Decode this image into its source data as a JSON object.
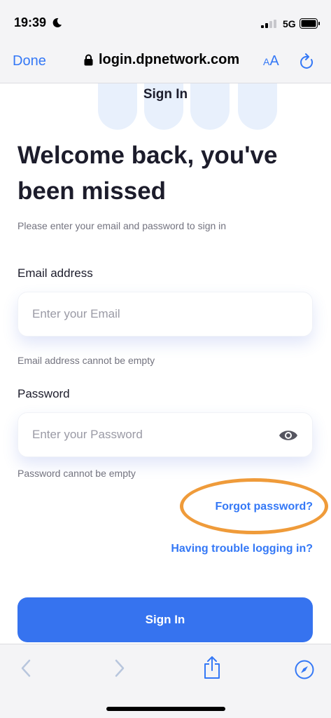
{
  "status_bar": {
    "time": "19:39",
    "network": "5G",
    "icons": [
      "moon-icon",
      "signal-icon",
      "battery-icon"
    ]
  },
  "browser": {
    "done_label": "Done",
    "url": "login.dpnetwork.com",
    "text_size_small": "A",
    "text_size_large": "A",
    "icons": [
      "lock-icon",
      "reload-icon",
      "back-icon",
      "forward-icon",
      "share-icon",
      "compass-icon"
    ]
  },
  "page": {
    "header": "Sign In",
    "title": "Welcome back, you've been missed",
    "subtitle": "Please enter your email and password to sign in",
    "email": {
      "label": "Email address",
      "placeholder": "Enter your Email",
      "value": "",
      "error": "Email address cannot be empty"
    },
    "password": {
      "label": "Password",
      "placeholder": "Enter your Password",
      "value": "",
      "error": "Password cannot be empty"
    },
    "forgot_password": "Forgot password?",
    "trouble_link": "Having trouble logging in?",
    "signin_button": "Sign In"
  },
  "colors": {
    "accent": "#3478f6",
    "button": "#3673ef",
    "highlight": "#ef9b3a",
    "decor": "#e8f0fc"
  }
}
